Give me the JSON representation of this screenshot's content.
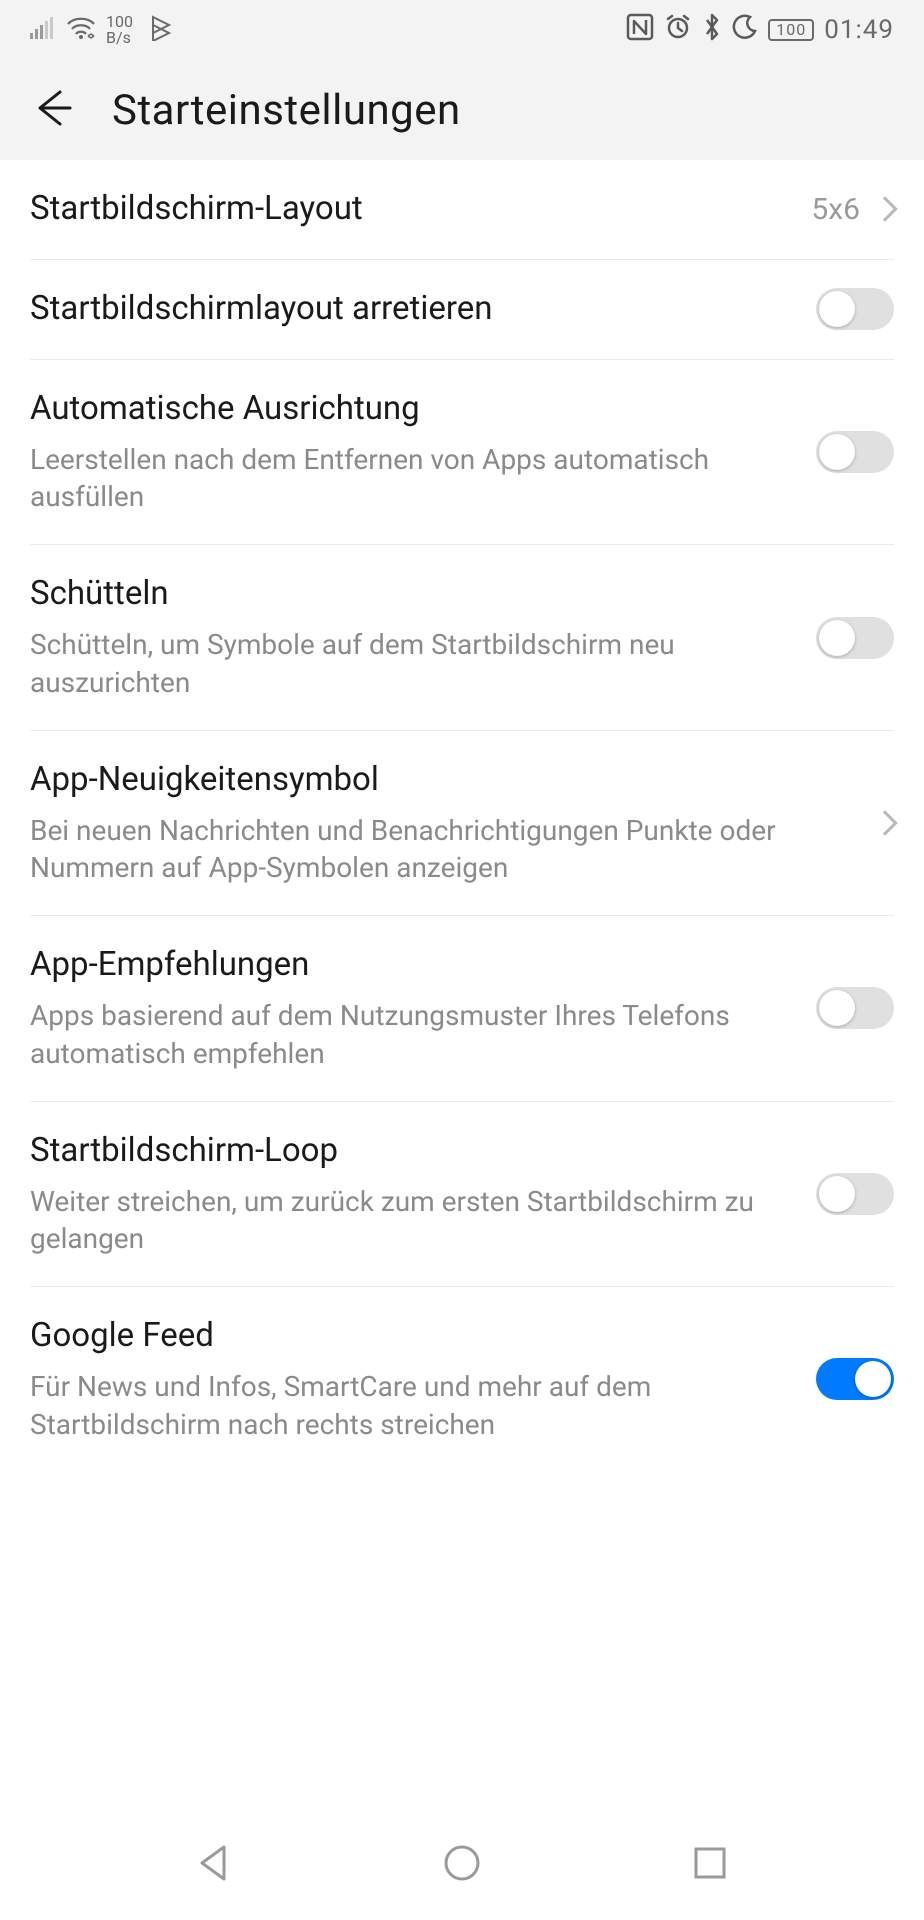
{
  "statusBar": {
    "speed_top": "100",
    "speed_bottom": "B/s",
    "battery": "100",
    "clock": "01:49"
  },
  "header": {
    "title": "Starteinstellungen"
  },
  "rows": {
    "layout": {
      "title": "Startbildschirm-Layout",
      "value": "5x6"
    },
    "lock": {
      "title": "Startbildschirmlayout arretieren"
    },
    "autoalign": {
      "title": "Automatische Ausrichtung",
      "sub": "Leerstellen nach dem Entfernen von Apps automatisch ausfüllen"
    },
    "shake": {
      "title": "Schütteln",
      "sub": "Schütteln, um Symbole auf dem Startbildschirm neu auszurichten"
    },
    "badge": {
      "title": "App-Neuigkeitensymbol",
      "sub": "Bei neuen Nachrichten und Benachrichtigungen Punkte oder Nummern auf App-Symbolen anzeigen"
    },
    "recs": {
      "title": "App-Empfehlungen",
      "sub": "Apps basierend auf dem Nutzungsmuster Ihres Telefons automatisch empfehlen"
    },
    "loop": {
      "title": "Startbildschirm-Loop",
      "sub": "Weiter streichen, um zurück zum ersten Startbildschirm zu gelangen"
    },
    "googlefeed": {
      "title": "Google Feed",
      "sub": "Für News und Infos, SmartCare und mehr auf dem Startbildschirm nach rechts streichen"
    }
  },
  "switches": {
    "lock": false,
    "autoalign": false,
    "shake": false,
    "recs": false,
    "loop": false,
    "googlefeed": true
  }
}
